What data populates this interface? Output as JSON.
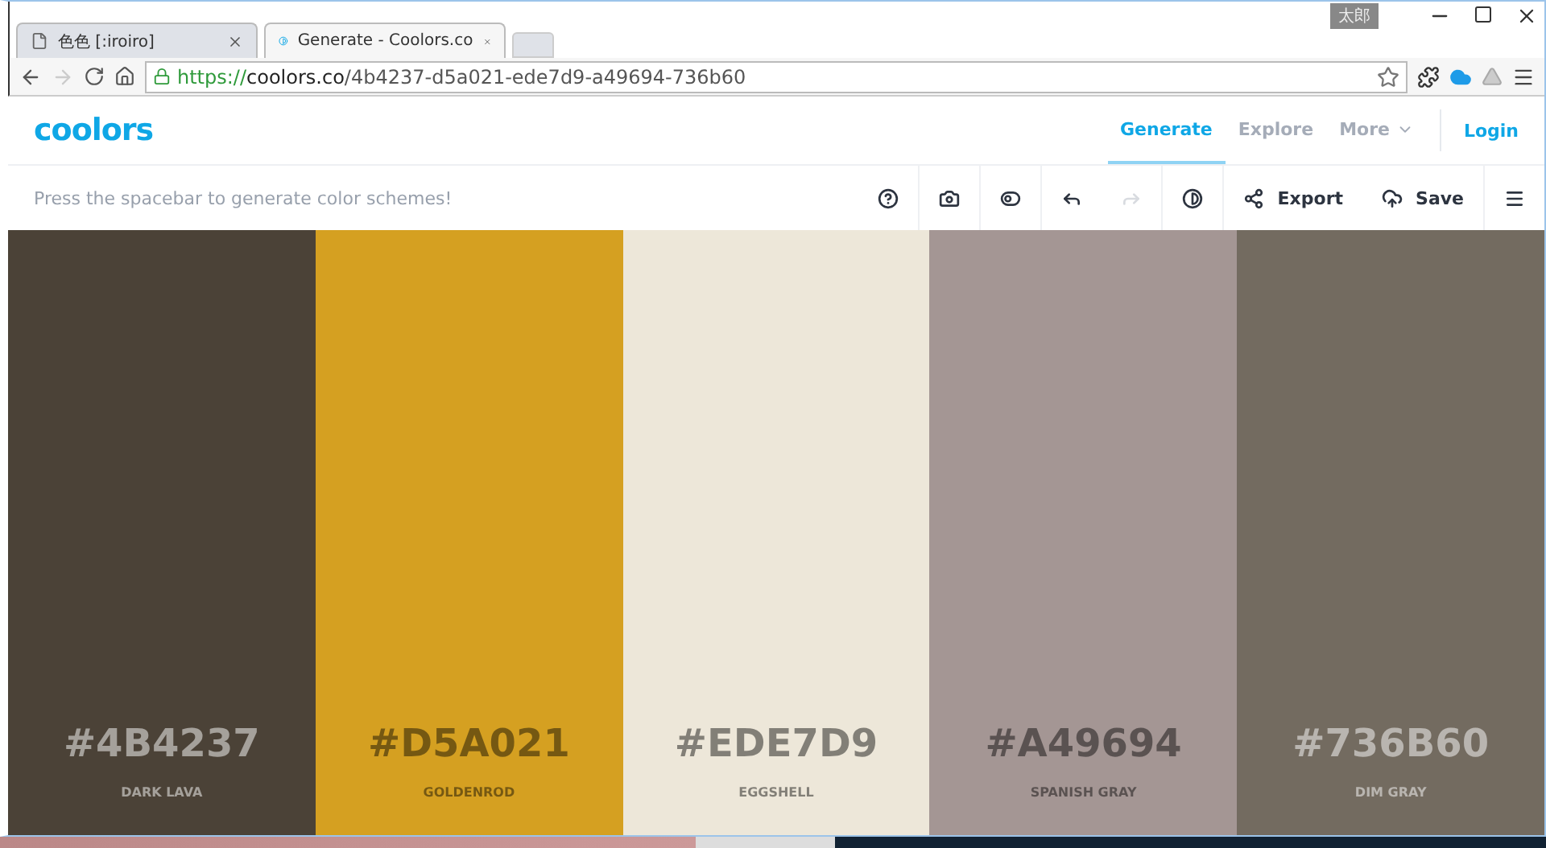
{
  "browser": {
    "tabs": [
      {
        "title": "色色 [:iroiro]",
        "selected": false,
        "kind": "page"
      },
      {
        "title": "Generate - Coolors.co",
        "selected": true,
        "kind": "site"
      }
    ],
    "user_badge": "太郎",
    "url": {
      "scheme": "https://",
      "host": "coolors.co",
      "path": "/4b4237-d5a021-ede7d9-a49694-736b60"
    },
    "forward_disabled": true
  },
  "site": {
    "logo": "coolors",
    "nav": [
      {
        "label": "Generate",
        "selected": true,
        "kind": "link"
      },
      {
        "label": "Explore",
        "selected": false,
        "kind": "link"
      },
      {
        "label": "More",
        "selected": false,
        "kind": "dropdown"
      }
    ],
    "login": "Login",
    "hint": "Press the spacebar to generate color schemes!",
    "tools": [
      {
        "kind": "help",
        "disabled": false
      },
      {
        "kind": "camera",
        "disabled": false
      },
      {
        "kind": "toggle",
        "disabled": false
      },
      {
        "kind": "undo",
        "disabled": false
      },
      {
        "kind": "redo",
        "disabled": true
      },
      {
        "kind": "contrast",
        "disabled": false
      },
      {
        "kind": "share",
        "label": "Export",
        "disabled": false
      },
      {
        "kind": "save",
        "label": "Save",
        "disabled": false
      },
      {
        "kind": "menu",
        "disabled": false
      }
    ]
  },
  "palette": [
    {
      "hex": "#4B4237",
      "name": "DARK LAVA",
      "color": "#4b4237"
    },
    {
      "hex": "#D5A021",
      "name": "GOLDENROD",
      "color": "#d5a021"
    },
    {
      "hex": "#EDE7D9",
      "name": "EGGSHELL",
      "color": "#ede7d9"
    },
    {
      "hex": "#A49694",
      "name": "SPANISH GRAY",
      "color": "#a49694"
    },
    {
      "hex": "#736B60",
      "name": "DIM GRAY",
      "color": "#736b60"
    }
  ]
}
